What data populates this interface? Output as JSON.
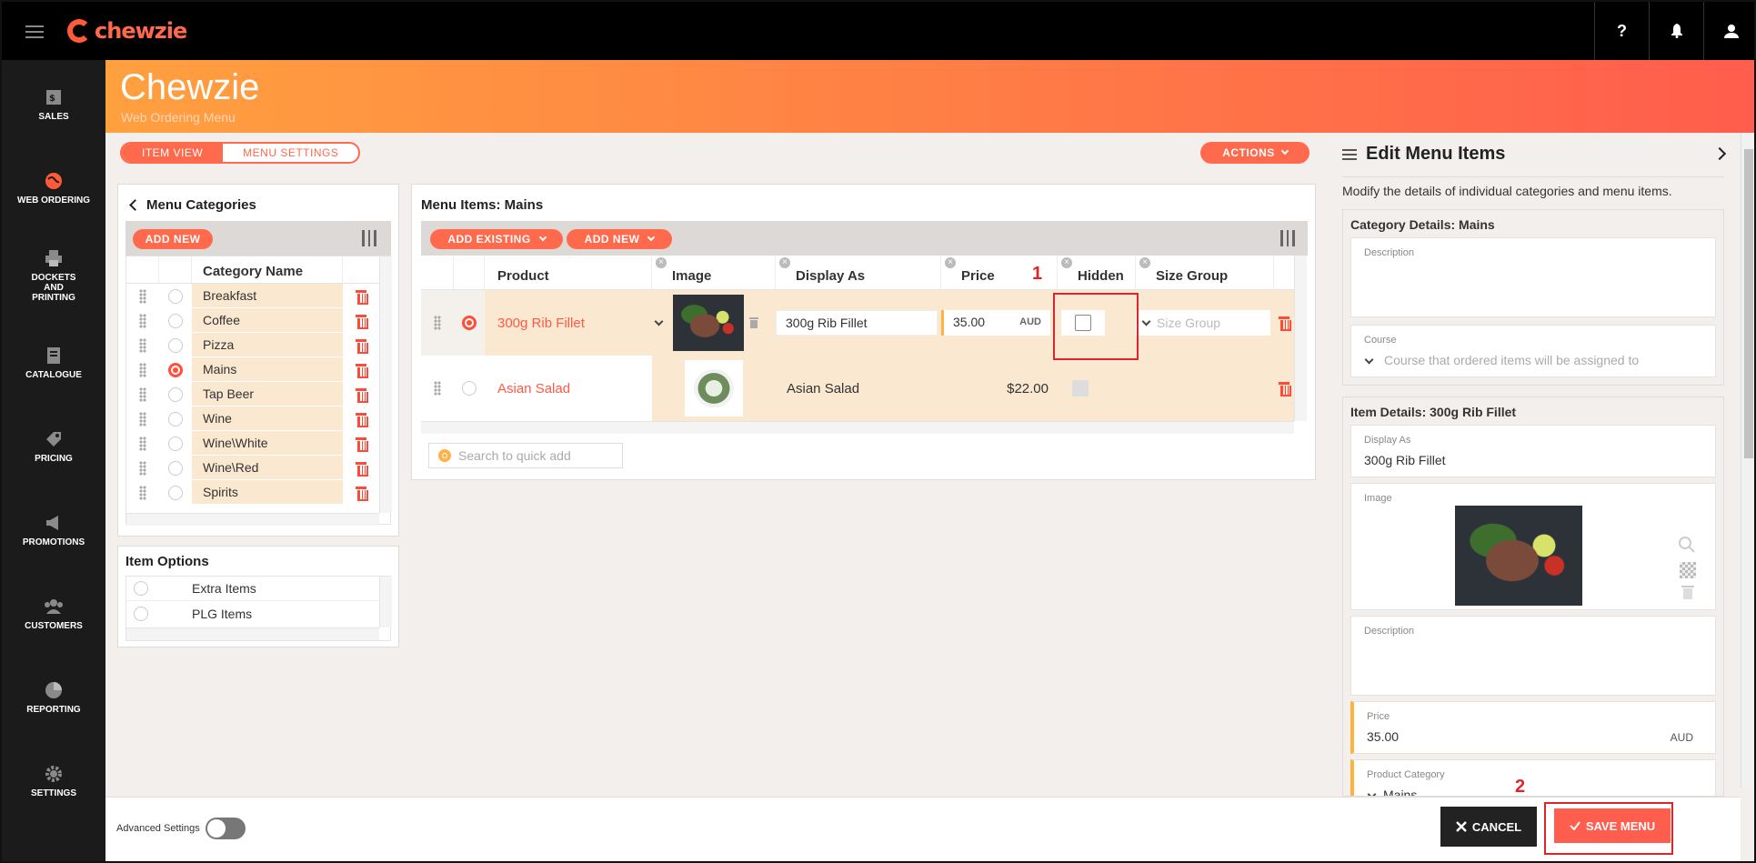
{
  "brand": {
    "logo_text": "chewzie",
    "accent": "#ff6a4d"
  },
  "topbar": {
    "help": "?",
    "icons": [
      "help-icon",
      "bell-icon",
      "user-icon"
    ]
  },
  "sidebar": {
    "items": [
      {
        "label": "SALES",
        "icon": "sales-icon"
      },
      {
        "label": "WEB ORDERING",
        "icon": "globe-icon"
      },
      {
        "label": "DOCKETS AND PRINTING",
        "icon": "printer-icon"
      },
      {
        "label": "CATALOGUE",
        "icon": "catalogue-icon"
      },
      {
        "label": "PRICING",
        "icon": "tag-icon"
      },
      {
        "label": "PROMOTIONS",
        "icon": "megaphone-icon"
      },
      {
        "label": "CUSTOMERS",
        "icon": "users-icon"
      },
      {
        "label": "REPORTING",
        "icon": "pie-chart-icon"
      },
      {
        "label": "SETTINGS",
        "icon": "gear-icon"
      }
    ]
  },
  "header": {
    "title": "Chewzie",
    "subtitle": "Web Ordering Menu"
  },
  "view_toggle": {
    "item_view": "ITEM VIEW",
    "menu_settings": "MENU SETTINGS"
  },
  "actions_label": "ACTIONS",
  "categories": {
    "title": "Menu Categories",
    "add_new": "ADD NEW",
    "column": "Category Name",
    "items": [
      "Breakfast",
      "Coffee",
      "Pizza",
      "Mains",
      "Tap Beer",
      "Wine",
      "Wine\\White",
      "Wine\\Red",
      "Spirits"
    ],
    "selected": "Mains"
  },
  "item_options": {
    "title": "Item Options",
    "items": [
      "Extra Items",
      "PLG Items"
    ]
  },
  "menu_items": {
    "title": "Menu Items: Mains",
    "add_existing": "ADD EXISTING",
    "add_new": "ADD NEW",
    "columns": {
      "product": "Product",
      "image": "Image",
      "display_as": "Display As",
      "price": "Price",
      "hidden": "Hidden",
      "size_group": "Size Group"
    },
    "rows": [
      {
        "product": "300g Rib Fillet",
        "display_as": "300g Rib Fillet",
        "price": "35.00",
        "currency": "AUD",
        "size_group_placeholder": "Size Group"
      },
      {
        "product": "Asian Salad",
        "display_as": "Asian Salad",
        "price": "$22.00"
      }
    ],
    "search_placeholder": "Search to quick add"
  },
  "annotations": {
    "one": "1",
    "two": "2"
  },
  "edit_panel": {
    "title": "Edit Menu Items",
    "intro": "Modify the details of individual categories and menu items.",
    "category_heading": "Category Details: Mains",
    "description_label": "Description",
    "course_label": "Course",
    "course_placeholder": "Course that ordered items will be assigned to",
    "item_heading": "Item Details: 300g Rib Fillet",
    "display_as_label": "Display As",
    "display_as_value": "300g Rib Fillet",
    "image_label": "Image",
    "item_description_label": "Description",
    "price_label": "Price",
    "price_value": "35.00",
    "currency": "AUD",
    "product_category_label": "Product Category",
    "product_category_value": "Mains"
  },
  "footer": {
    "advanced_settings": "Advanced Settings",
    "cancel": "CANCEL",
    "save": "SAVE MENU"
  }
}
